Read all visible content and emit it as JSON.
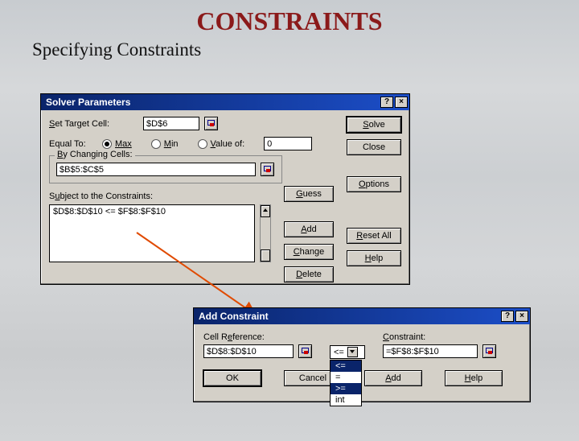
{
  "slide": {
    "title": "CONSTRAINTS",
    "subtitle": "Specifying Constraints"
  },
  "solver": {
    "window_title": "Solver Parameters",
    "set_target_label": "Set Target Cell:",
    "target_cell": "$D$6",
    "equal_to_label": "Equal To:",
    "radio_max": "Max",
    "radio_min": "Min",
    "radio_value_of": "Value of:",
    "value_of": "0",
    "changing_legend": "By Changing Cells:",
    "changing_cells": "$B$5:$C$5",
    "subject_label": "Subject to the Constraints:",
    "constraint_row": "$D$8:$D$10 <= $F$8:$F$10",
    "buttons": {
      "solve": "Solve",
      "close": "Close",
      "guess": "Guess",
      "options": "Options",
      "add": "Add",
      "change": "Change",
      "delete": "Delete",
      "reset": "Reset All",
      "help": "Help"
    }
  },
  "add": {
    "window_title": "Add Constraint",
    "cell_ref_label": "Cell Reference:",
    "cell_ref": "$D$8:$D$10",
    "operator": "<=",
    "operator_options": [
      "<=",
      "=",
      ">=",
      "int"
    ],
    "constraint_label": "Constraint:",
    "constraint": "=$F$8:$F$10",
    "buttons": {
      "ok": "OK",
      "cancel": "Cancel",
      "add": "Add",
      "help": "Help"
    }
  }
}
